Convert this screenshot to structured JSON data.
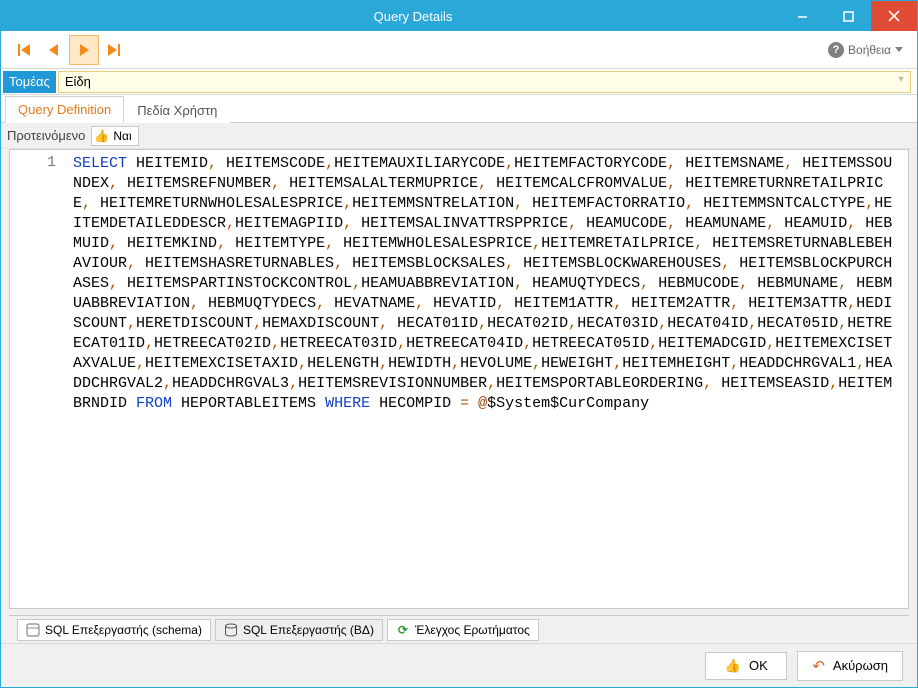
{
  "window": {
    "title": "Query Details"
  },
  "toolbar": {
    "help_label": "Βοήθεια"
  },
  "domain_field": {
    "label": "Τομέας",
    "value": "Είδη"
  },
  "tabs": {
    "query_definition": "Query Definition",
    "user_fields": "Πεδία Χρήστη"
  },
  "recommended": {
    "label": "Προτεινόμενο",
    "value": "Ναι"
  },
  "editor": {
    "line_number": "1"
  },
  "sql": {
    "select": "SELECT",
    "from": "FROM",
    "where": "WHERE",
    "table": "HEPORTABLEITEMS",
    "condition_col": "HECOMPID",
    "eq": "=",
    "param_prefix": "@",
    "param_body": "$System$CurCompany",
    "col_segments": [
      "HEITEMID, HEITEMSCODE,HEITEMAUXILIARYCODE,HEITEMFACTORYCODE, HEITEMSNAME, HEITEMSSOUNDEX, HEITEMSREFNUMBER, HEITEMSALALTERMUPRICE, HEITEMCALCFROMVALUE, HEITEMRETURNRETAILPRICE, HEITEMRETURNWHOLESALESPRICE,HEITEMMSNTRELATION, HEITEMFACTORRATIO, HEITEMMSNTCALCTYPE,HEITEMDETAILEDDESCR,HEITEMAGPIID, HEITEMSALINVATTRSPPRICE, HEAMUCODE, HEAMUNAME, HEAMUID, HEBMUID, HEITEMKIND, HEITEMTYPE, HEITEMWHOLESALESPRICE,HEITEMRETAILPRICE, HEITEMSRETURNABLEBEHAVIOUR, HEITEMSHASRETURNABLES, HEITEMSBLOCKSALES, HEITEMSBLOCKWAREHOUSES, HEITEMSBLOCKPURCHASES, HEITEMSPARTINSTOCKCONTROL,HEAMUABBREVIATION, HEAMUQTYDECS, HEBMUCODE, HEBMUNAME, HEBMUABBREVIATION, HEBMUQTYDECS, HEVATNAME, HEVATID, HEITEM1ATTR, HEITEM2ATTR, HEITEM3ATTR,HEDISCOUNT,HERETDISCOUNT,HEMAXDISCOUNT, HECAT01ID,HECAT02ID,HECAT03ID,HECAT04ID,HECAT05ID,HETREECAT01ID,HETREECAT02ID,HETREECAT03ID,HETREECAT04ID,HETREECAT05ID,HEITEMADCGID,HEITEMEXCISETAXVALUE,HEITEMEXCISETAXID,HELENGTH,HEWIDTH,HEVOLUME,HEWEIGHT,HEITEMHEIGHT,HEADDCHRGVAL1,HEADDCHRGVAL2,HEADDCHRGVAL3,HEITEMSREVISIONNUMBER,HEITEMSPORTABLEORDERING, HEITEMSEASID,HEITEMBRNDID"
    ]
  },
  "bottom_tabs": {
    "schema": "SQL Επεξεργαστής (schema)",
    "db": "SQL Επεξεργαστής (ΒΔ)",
    "check": "Έλεγχος Ερωτήματος"
  },
  "footer": {
    "ok": "OK",
    "cancel": "Ακύρωση"
  }
}
